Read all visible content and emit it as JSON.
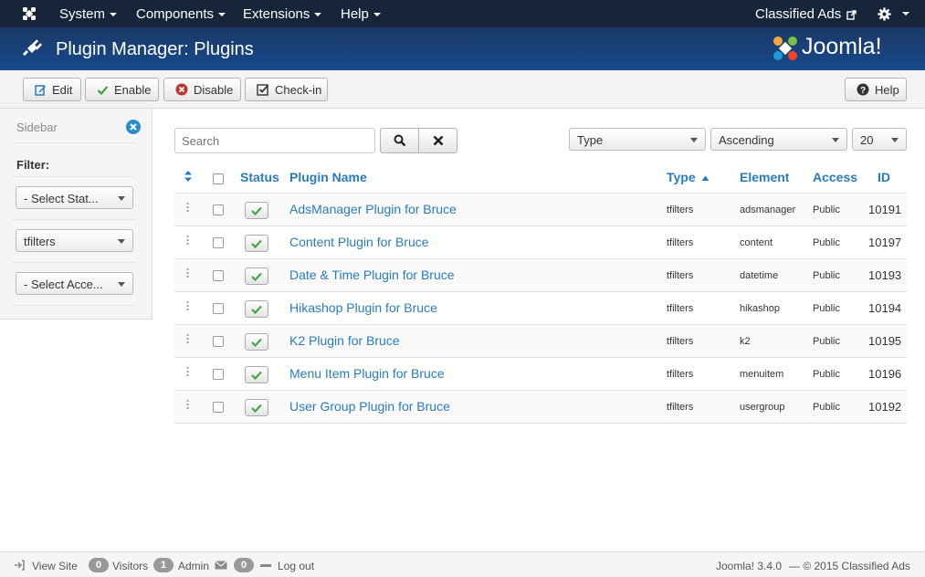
{
  "navbar": {
    "menus": [
      "System",
      "Components",
      "Extensions",
      "Help"
    ],
    "site_link": "Classified Ads"
  },
  "header": {
    "title": "Plugin Manager: Plugins",
    "brand": "Joomla!"
  },
  "toolbar": {
    "edit_label": "Edit",
    "enable_label": "Enable",
    "disable_label": "Disable",
    "checkin_label": "Check-in",
    "help_label": "Help"
  },
  "sidebar": {
    "title": "Sidebar",
    "filter_label": "Filter:",
    "filters": [
      "- Select Stat...",
      "tfilters",
      "- Select Acce..."
    ]
  },
  "search": {
    "placeholder": "Search"
  },
  "sorting": {
    "order_field": "Type",
    "direction": "Ascending",
    "limit": "20"
  },
  "table": {
    "columns": {
      "status": "Status",
      "name": "Plugin Name",
      "type": "Type",
      "element": "Element",
      "access": "Access",
      "id": "ID"
    },
    "rows": [
      {
        "name": "AdsManager Plugin for Bruce",
        "type": "tfilters",
        "element": "adsmanager",
        "access": "Public",
        "id": "10191"
      },
      {
        "name": "Content Plugin for Bruce",
        "type": "tfilters",
        "element": "content",
        "access": "Public",
        "id": "10197"
      },
      {
        "name": "Date & Time Plugin for Bruce",
        "type": "tfilters",
        "element": "datetime",
        "access": "Public",
        "id": "10193"
      },
      {
        "name": "Hikashop Plugin for Bruce",
        "type": "tfilters",
        "element": "hikashop",
        "access": "Public",
        "id": "10194"
      },
      {
        "name": "K2 Plugin for Bruce",
        "type": "tfilters",
        "element": "k2",
        "access": "Public",
        "id": "10195"
      },
      {
        "name": "Menu Item Plugin for Bruce",
        "type": "tfilters",
        "element": "menuitem",
        "access": "Public",
        "id": "10196"
      },
      {
        "name": "User Group Plugin for Bruce",
        "type": "tfilters",
        "element": "usergroup",
        "access": "Public",
        "id": "10192"
      }
    ]
  },
  "statusbar": {
    "view_site": "View Site",
    "visitors_count": "0",
    "visitors_label": "Visitors",
    "admin_count": "1",
    "admin_label": "Admin",
    "messages_count": "0",
    "logout_label": "Log out",
    "version": "Joomla! 3.4.0",
    "copyright": "— © 2015 Classified Ads"
  },
  "colors": {
    "navbar": "#17253b",
    "header": "#184a8d",
    "link": "#2a7bbd",
    "enable_icon": "#46a546",
    "disable_icon": "#bd362f"
  }
}
